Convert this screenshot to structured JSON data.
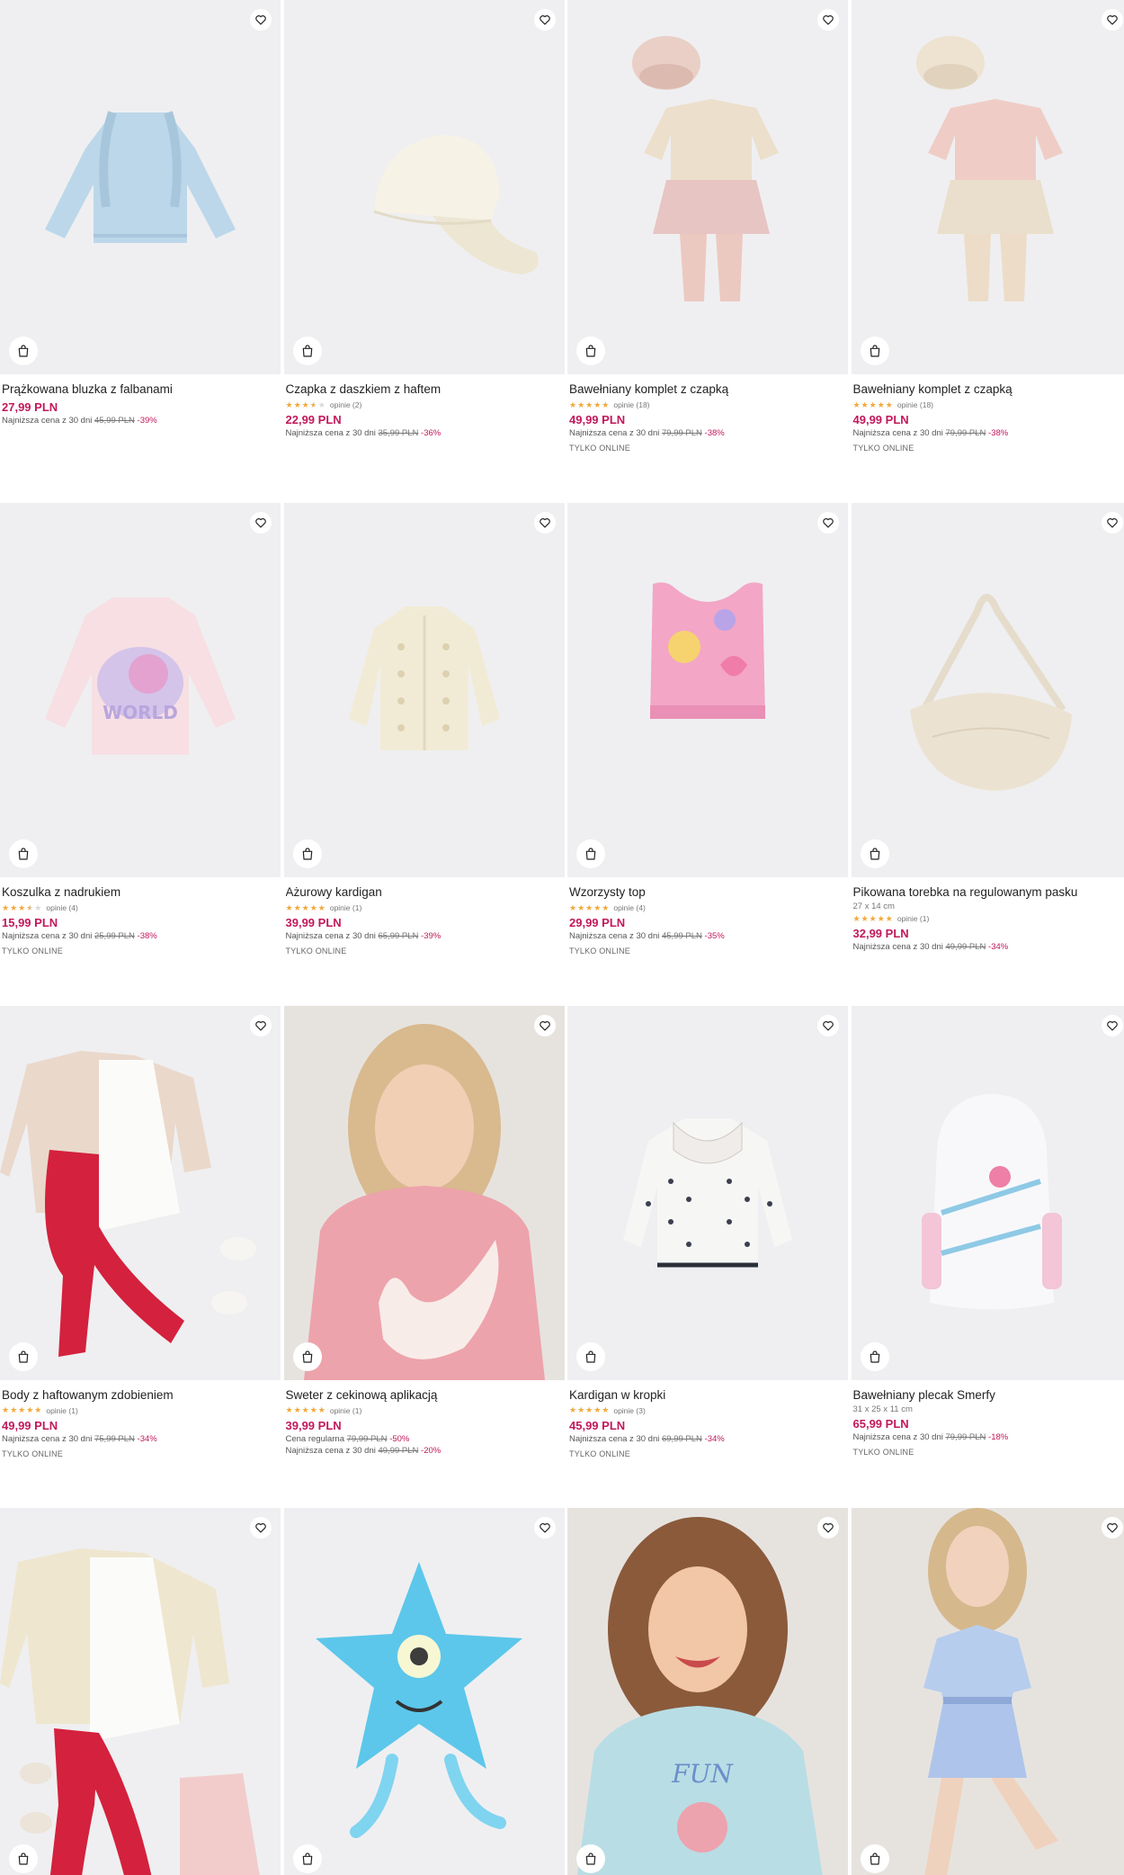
{
  "icons": {
    "favorite": "heart-outline-icon",
    "cart": "shopping-bag-icon"
  },
  "colors": {
    "price": "#c2185b",
    "star": "#f2a93b",
    "image_bg": "#efeff1"
  },
  "products": [
    {
      "name": "Prążkowana bluzka z falbanami",
      "price": "27,99 PLN",
      "lowest_label": "Najniższa cena z 30 dni",
      "old_price": "45,99 PLN",
      "discount": "-39%"
    },
    {
      "name": "Czapka z daszkiem z haftem",
      "rating": 3.5,
      "reviews": "opinie (2)",
      "price": "22,99 PLN",
      "lowest_label": "Najniższa cena z 30 dni",
      "old_price": "35,99 PLN",
      "discount": "-36%"
    },
    {
      "name": "Bawełniany komplet z czapką",
      "rating": 5,
      "reviews": "opinie (18)",
      "price": "49,99 PLN",
      "lowest_label": "Najniższa cena z 30 dni",
      "old_price": "79,99 PLN",
      "discount": "-38%",
      "badge": "TYLKO ONLINE"
    },
    {
      "name": "Bawełniany komplet z czapką",
      "rating": 5,
      "reviews": "opinie (18)",
      "price": "49,99 PLN",
      "lowest_label": "Najniższa cena z 30 dni",
      "old_price": "79,99 PLN",
      "discount": "-38%",
      "badge": "TYLKO ONLINE"
    },
    {
      "name": "Koszulka z nadrukiem",
      "rating": 3.5,
      "reviews": "opinie (4)",
      "price": "15,99 PLN",
      "lowest_label": "Najniższa cena z 30 dni",
      "old_price": "25,99 PLN",
      "discount": "-38%",
      "badge": "TYLKO ONLINE"
    },
    {
      "name": "Ażurowy kardigan",
      "rating": 5,
      "reviews": "opinie (1)",
      "price": "39,99 PLN",
      "lowest_label": "Najniższa cena z 30 dni",
      "old_price": "65,99 PLN",
      "discount": "-39%",
      "badge": "TYLKO ONLINE"
    },
    {
      "name": "Wzorzysty top",
      "rating": 5,
      "reviews": "opinie (4)",
      "price": "29,99 PLN",
      "lowest_label": "Najniższa cena z 30 dni",
      "old_price": "45,99 PLN",
      "discount": "-35%",
      "badge": "TYLKO ONLINE"
    },
    {
      "name": "Pikowana torebka na regulowanym pasku",
      "dims": "27 x 14 cm",
      "rating": 5,
      "reviews": "opinie (1)",
      "price": "32,99 PLN",
      "lowest_label": "Najniższa cena z 30 dni",
      "old_price": "49,99 PLN",
      "discount": "-34%"
    },
    {
      "name": "Body z haftowanym zdobieniem",
      "rating": 5,
      "reviews": "opinie (1)",
      "price": "49,99 PLN",
      "lowest_label": "Najniższa cena z 30 dni",
      "old_price": "75,99 PLN",
      "discount": "-34%",
      "badge": "TYLKO ONLINE"
    },
    {
      "name": "Sweter z cekinową aplikacją",
      "rating": 5,
      "reviews": "opinie (1)",
      "price": "39,99 PLN",
      "regular_label": "Cena regularna",
      "regular_price": "79,99 PLN",
      "regular_discount": "-50%",
      "lowest_label": "Najniższa cena z 30 dni",
      "old_price": "49,99 PLN",
      "discount": "-20%"
    },
    {
      "name": "Kardigan w kropki",
      "rating": 5,
      "reviews": "opinie (3)",
      "price": "45,99 PLN",
      "lowest_label": "Najniższa cena z 30 dni",
      "old_price": "69,99 PLN",
      "discount": "-34%",
      "badge": "TYLKO ONLINE"
    },
    {
      "name": "Bawełniany plecak Smerfy",
      "dims": "31 x 25 x 11 cm",
      "price": "65,99 PLN",
      "lowest_label": "Najniższa cena z 30 dni",
      "old_price": "79,99 PLN",
      "discount": "-18%",
      "badge": "TYLKO ONLINE"
    },
    {},
    {},
    {},
    {}
  ]
}
